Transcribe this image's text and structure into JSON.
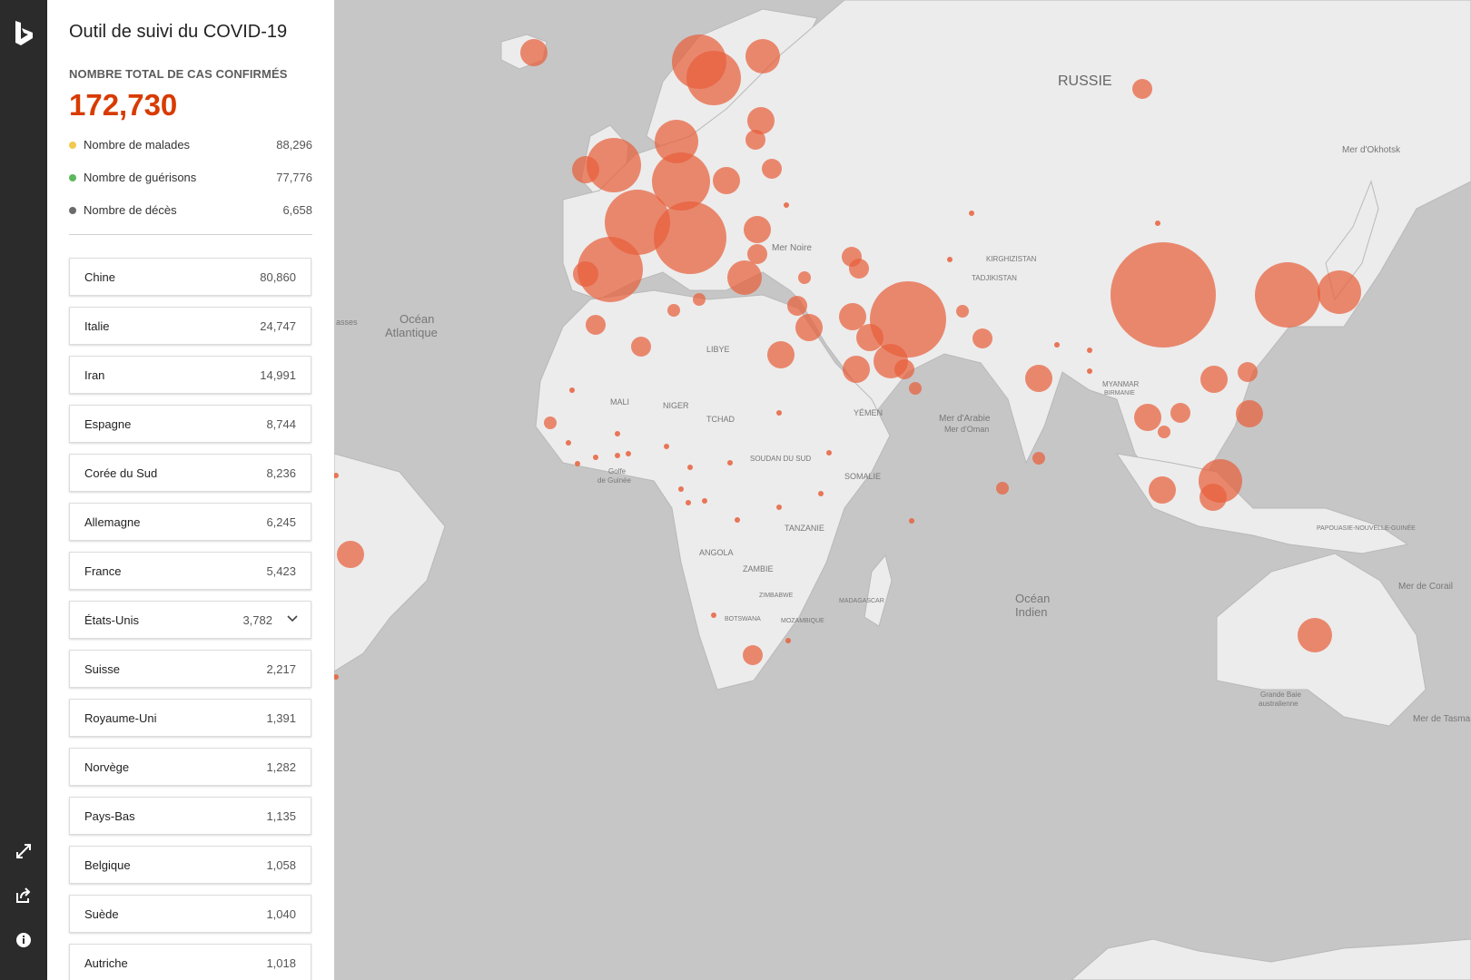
{
  "panel": {
    "title": "Outil de suivi du COVID-19",
    "total_label": "NOMBRE TOTAL DE CAS CONFIRMÉS",
    "total": "172,730",
    "stats": [
      {
        "label": "Nombre de malades",
        "value": "88,296",
        "color": "#f2c94c"
      },
      {
        "label": "Nombre de guérisons",
        "value": "77,776",
        "color": "#5cb85c"
      },
      {
        "label": "Nombre de décès",
        "value": "6,658",
        "color": "#6b6b6b"
      }
    ],
    "countries": [
      {
        "name": "Chine",
        "value": "80,860"
      },
      {
        "name": "Italie",
        "value": "24,747"
      },
      {
        "name": "Iran",
        "value": "14,991"
      },
      {
        "name": "Espagne",
        "value": "8,744"
      },
      {
        "name": "Corée du Sud",
        "value": "8,236"
      },
      {
        "name": "Allemagne",
        "value": "6,245"
      },
      {
        "name": "France",
        "value": "5,423"
      },
      {
        "name": "États-Unis",
        "value": "3,782"
      },
      {
        "name": "Suisse",
        "value": "2,217"
      },
      {
        "name": "Royaume-Uni",
        "value": "1,391"
      },
      {
        "name": "Norvège",
        "value": "1,282"
      },
      {
        "name": "Pays-Bas",
        "value": "1,135"
      },
      {
        "name": "Belgique",
        "value": "1,058"
      },
      {
        "name": "Suède",
        "value": "1,040"
      },
      {
        "name": "Autriche",
        "value": "1,018"
      }
    ]
  },
  "rail": {
    "icons": [
      "bing-logo-icon",
      "expand-icon",
      "share-icon",
      "info-icon"
    ]
  },
  "map": {
    "land_color": "#ececec",
    "water_color": "#c6c6c6",
    "bubble_color": "#e8603c",
    "labels": {
      "russie": "RUSSIE",
      "okhotsk": "Mer d'Okhotsk",
      "ocean_atlantique_1": "Océan",
      "ocean_atlantique_2": "Atlantique",
      "mer_noire": "Mer Noire",
      "kirghizistan": "KIRGHIZISTAN",
      "tadjikistan": "TADJIKISTAN",
      "libye": "LIBYE",
      "mali": "MALI",
      "niger": "NIGER",
      "tchad": "TCHAD",
      "yemen": "YÉMEN",
      "soudan_sud": "SOUDAN DU SUD",
      "somalie": "SOMALIE",
      "golfe_1": "Golfe",
      "golfe_2": "de Guinée",
      "tanzanie": "TANZANIE",
      "angola": "ANGOLA",
      "zambie": "ZAMBIE",
      "zimbabwe": "ZIMBABWE",
      "botswana": "BOTSWANA",
      "mozambique": "MOZAMBIQUE",
      "madagascar": "MADAGASCAR",
      "mer_arabie": "Mer d'Arabie",
      "mer_oman": "Mer d'Oman",
      "ocean_indien_1": "Océan",
      "ocean_indien_2": "Indien",
      "myanmar": "MYANMAR",
      "birmanie": "BIRMANIE",
      "papouasie": "PAPOUASIE-NOUVELLE-GUINÉE",
      "mer_corail": "Mer de Corail",
      "grande_baie_1": "Grande Baie",
      "grande_baie_2": "australienne",
      "mer_tasman": "Mer de Tasma",
      "asses": "asses"
    }
  }
}
